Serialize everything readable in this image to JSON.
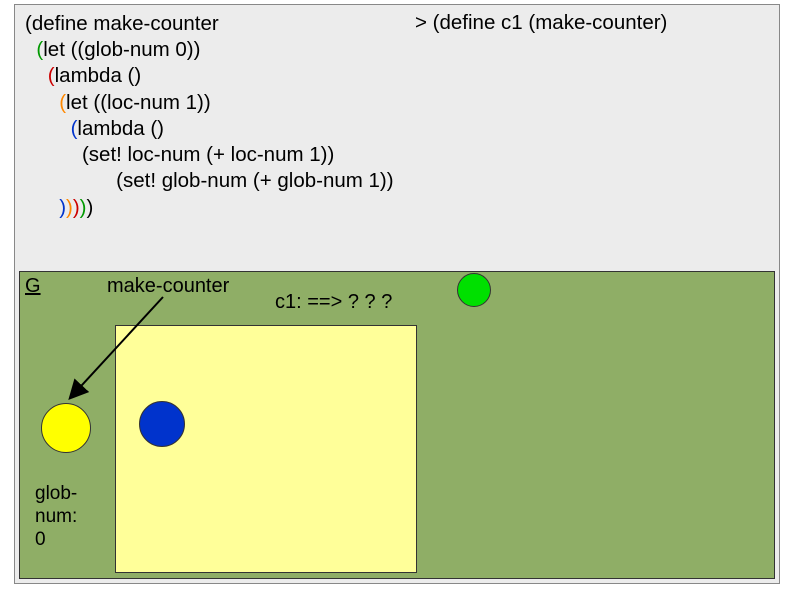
{
  "code": {
    "l1a": "(define make-counter",
    "l2a": "(",
    "l2b": "let ((glob-num 0))",
    "l3a": "(",
    "l3b": "lambda ()",
    "l4a": "(",
    "l4b": "let ((loc-num 1))",
    "l5a": "(",
    "l5b": "lambda ()",
    "l6": "(set! loc-num (+ loc-num 1))",
    "l7": "(set! glob-num (+ glob-num 1))",
    "close_blue": ")",
    "close_orange": ")",
    "close_red": ")",
    "close_green": ")",
    "close_black": ")"
  },
  "repl": {
    "line": "> (define c1 (make-counter)"
  },
  "env": {
    "g_label": "G",
    "make_counter_label": "make-counter",
    "c1_label": "c1: ==> ? ? ?",
    "globnum_l1": "glob-",
    "globnum_l2": "num:",
    "globnum_l3": "0"
  },
  "icons": {
    "yellow_circle": "value-circle-yellow",
    "blue_circle": "value-circle-blue",
    "green_circle": "value-circle-green"
  }
}
